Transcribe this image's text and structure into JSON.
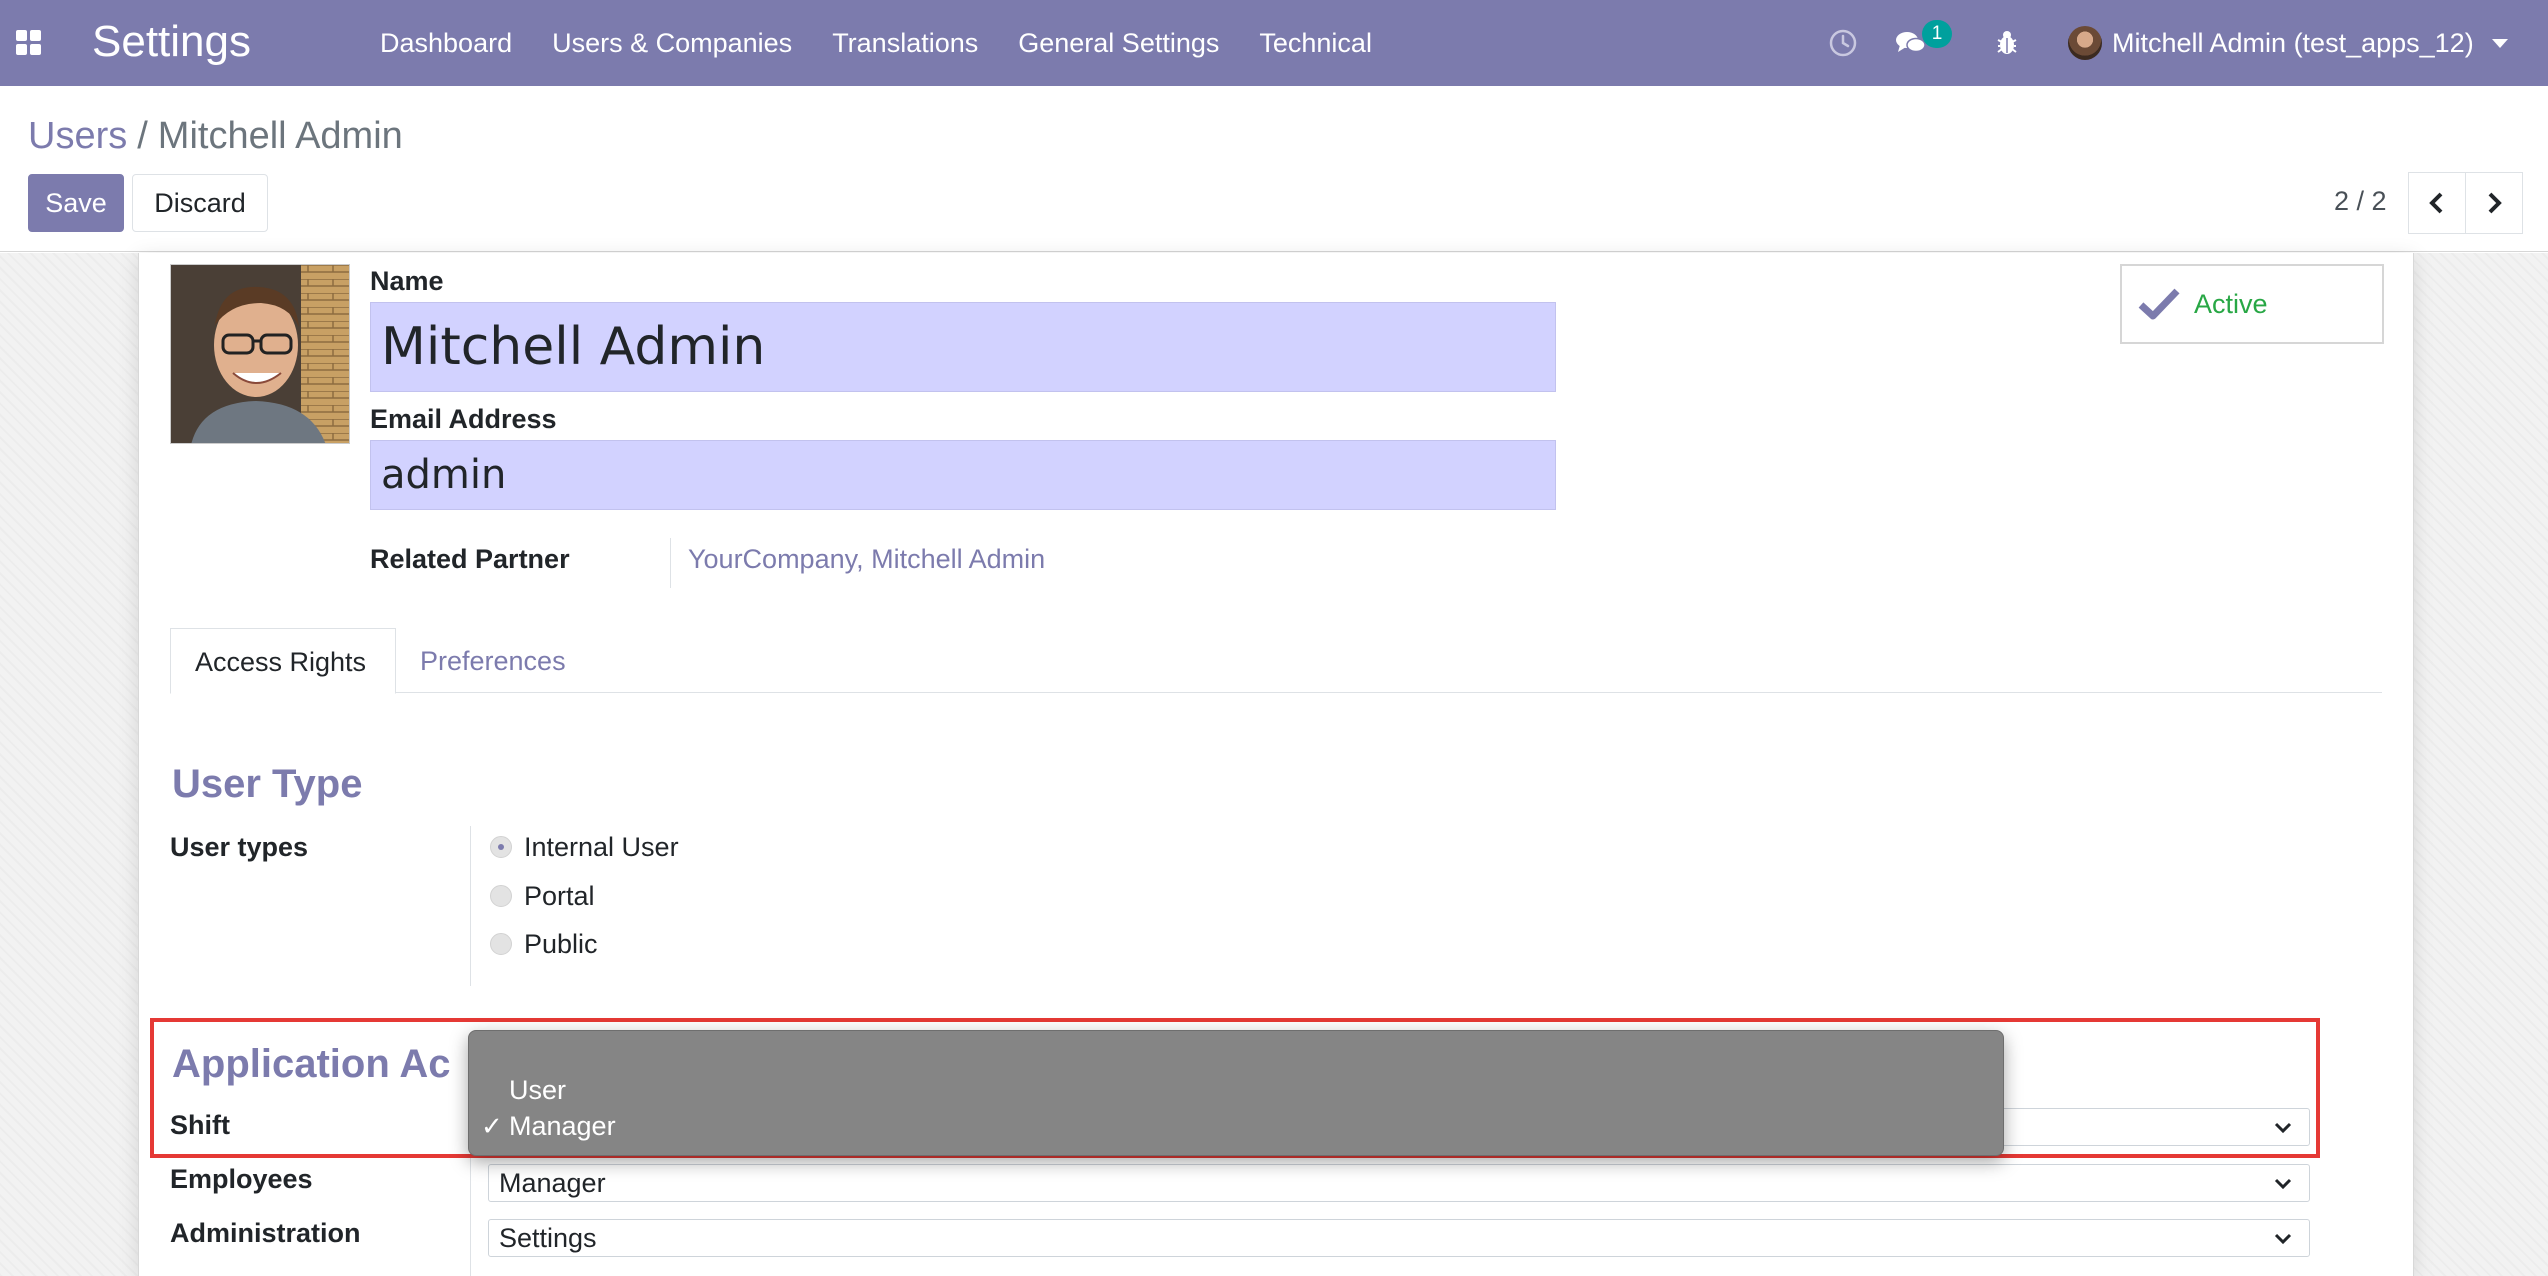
{
  "navbar": {
    "app_title": "Settings",
    "menu": [
      "Dashboard",
      "Users & Companies",
      "Translations",
      "General Settings",
      "Technical"
    ],
    "chat_badge": "1",
    "user_label": "Mitchell Admin (test_apps_12)",
    "icons": [
      "apps-grid-icon",
      "clock-icon",
      "chat-icon",
      "bug-icon",
      "user-avatar",
      "caret-down-icon"
    ]
  },
  "breadcrumb": {
    "parent": "Users",
    "separator": "/",
    "current": "Mitchell Admin"
  },
  "toolbar": {
    "save_label": "Save",
    "discard_label": "Discard",
    "pager_value": "2 / 2"
  },
  "user_form": {
    "name_label": "Name",
    "name_value": "Mitchell Admin",
    "email_label": "Email Address",
    "email_value": "admin",
    "related_partner_label": "Related Partner",
    "related_partner_value": "YourCompany, Mitchell Admin",
    "active_label": "Active"
  },
  "tabs": {
    "access_rights": "Access Rights",
    "preferences": "Preferences"
  },
  "user_type": {
    "section_title": "User Type",
    "field_label": "User types",
    "options": [
      "Internal User",
      "Portal",
      "Public"
    ],
    "selected": "Internal User"
  },
  "application_access": {
    "section_title": "Application Ac",
    "rows": [
      {
        "label": "Shift",
        "value": ""
      },
      {
        "label": "Employees",
        "value": "Manager"
      },
      {
        "label": "Administration",
        "value": "Settings"
      }
    ]
  },
  "dropdown": {
    "options": [
      "User",
      "Manager"
    ],
    "selected": "Manager",
    "check_mark": "✓"
  },
  "colors": {
    "brand": "#7c7bad",
    "input_highlight": "#d2d2ff",
    "active_green": "#28a745",
    "badge_teal": "#00a09d",
    "highlight_red": "#e53935"
  }
}
